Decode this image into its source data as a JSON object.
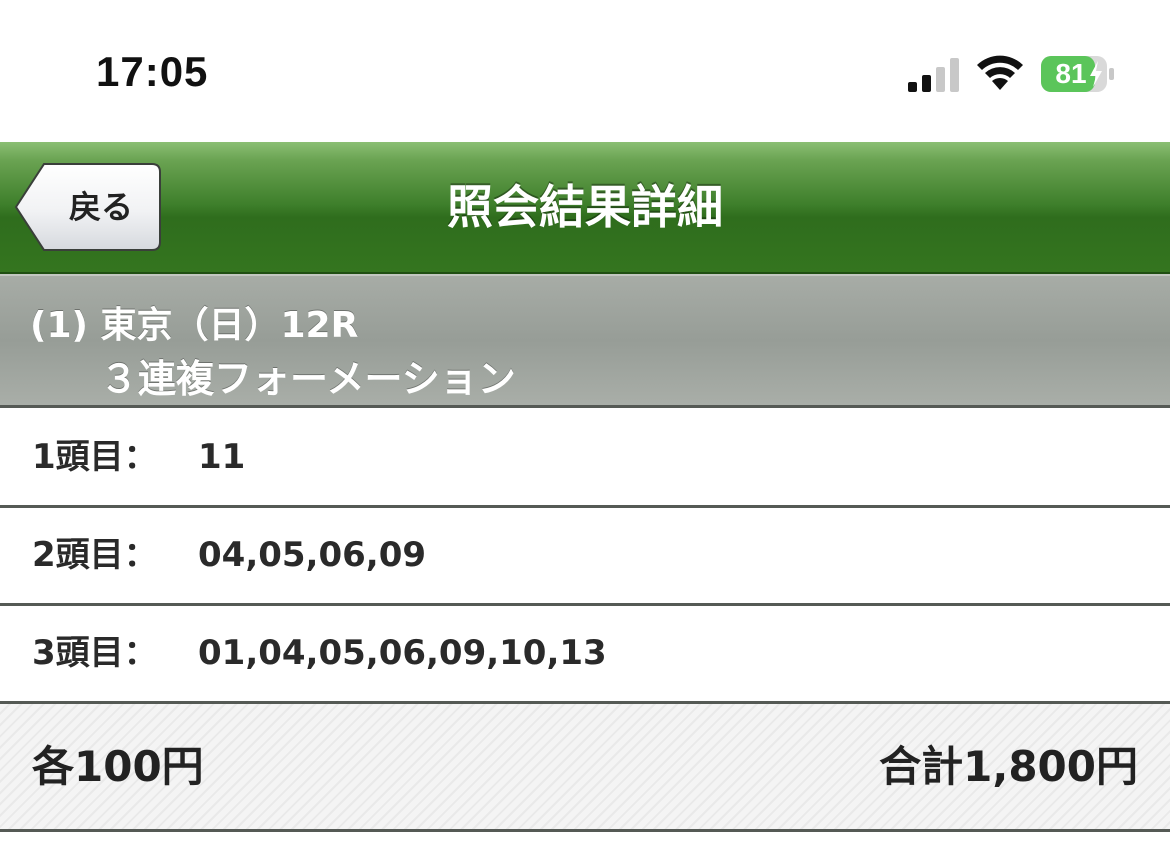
{
  "status_bar": {
    "time": "17:05",
    "battery_level": "81",
    "icons": [
      "signal-icon",
      "wifi-icon",
      "battery-charging-icon"
    ]
  },
  "nav": {
    "back_label": "戻る",
    "title": "照会結果詳細",
    "bar_color": "#3e7f2b"
  },
  "race": {
    "line1": "(1) 東京（日）12R",
    "line2": "３連複フォーメーション"
  },
  "selections": [
    {
      "label": "1頭目：",
      "value": "11"
    },
    {
      "label": "2頭目：",
      "value": "04,05,06,09"
    },
    {
      "label": "3頭目：",
      "value": "01,04,05,06,09,10,13"
    }
  ],
  "totals": {
    "unit_price": "各100円",
    "total_price": "合計1,800円"
  },
  "colors": {
    "battery_green": "#5bc55a",
    "header_gray": "#979d97",
    "divider": "#555a55"
  }
}
